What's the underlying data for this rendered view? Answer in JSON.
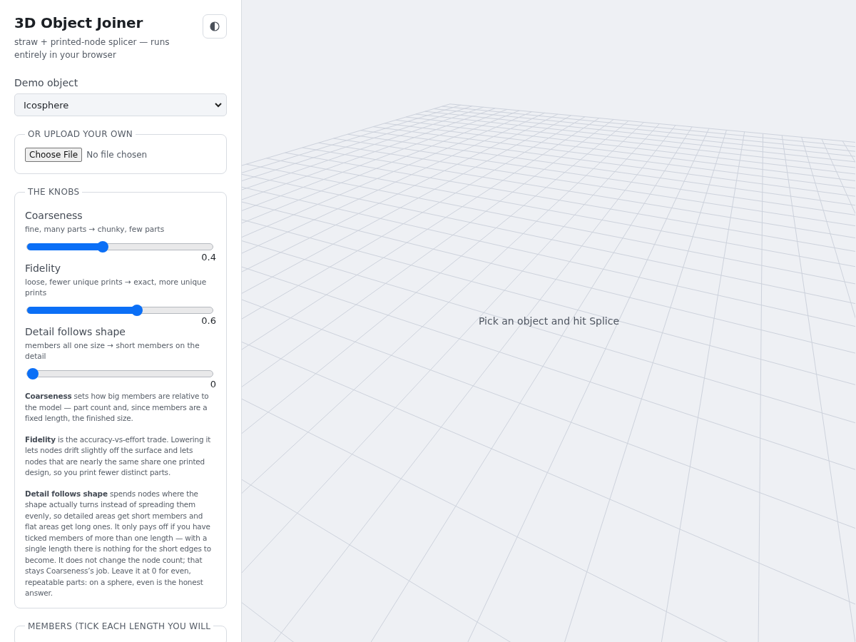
{
  "app": {
    "title": "3D Object Joiner",
    "subtitle": "straw + printed-node splicer — runs entirely in your browser"
  },
  "demo": {
    "label": "Demo object",
    "value": "Icosphere"
  },
  "upload": {
    "legend": "OR UPLOAD YOUR OWN",
    "button": "Choose File",
    "status": "No file chosen"
  },
  "knobs": {
    "legend": "THE KNOBS",
    "sliders": [
      {
        "name": "Coarseness",
        "hint": "fine, many parts → chunky, few parts",
        "level": 0.4,
        "reading": "0.4"
      },
      {
        "name": "Fidelity",
        "hint": "loose, fewer unique prints → exact, more unique prints",
        "level": 0.6,
        "reading": "0.6"
      },
      {
        "name": "Detail follows shape",
        "hint": "members all one size → short members on the detail",
        "level": 0,
        "reading": "0"
      }
    ],
    "notes": [
      "**Coarseness** sets how big members are relative to the model — part count and, since members are a fixed length, the finished size.",
      "**Fidelity** is the accuracy-vs-effort trade. Lowering it lets nodes drift slightly off the surface and lets nodes that are nearly the same share one printed design, so you print fewer distinct parts.",
      "**Detail follows shape** spends nodes where the shape actually turns instead of spreading them evenly, so detailed areas get short members and flat areas get long ones. It only pays off if you have ticked members of more than one length — with a single length there is nothing for the short edges to become. It does not change the node count; that stays Coarseness’s job. Leave it at 0 for even, repeatable parts: on a sphere, even is the honest answer."
    ]
  },
  "members": {
    "legend": "MEMBERS (TICK EACH LENGTH YOU WILL"
  },
  "viewport": {
    "message": "Pick an object and hit Splice"
  }
}
